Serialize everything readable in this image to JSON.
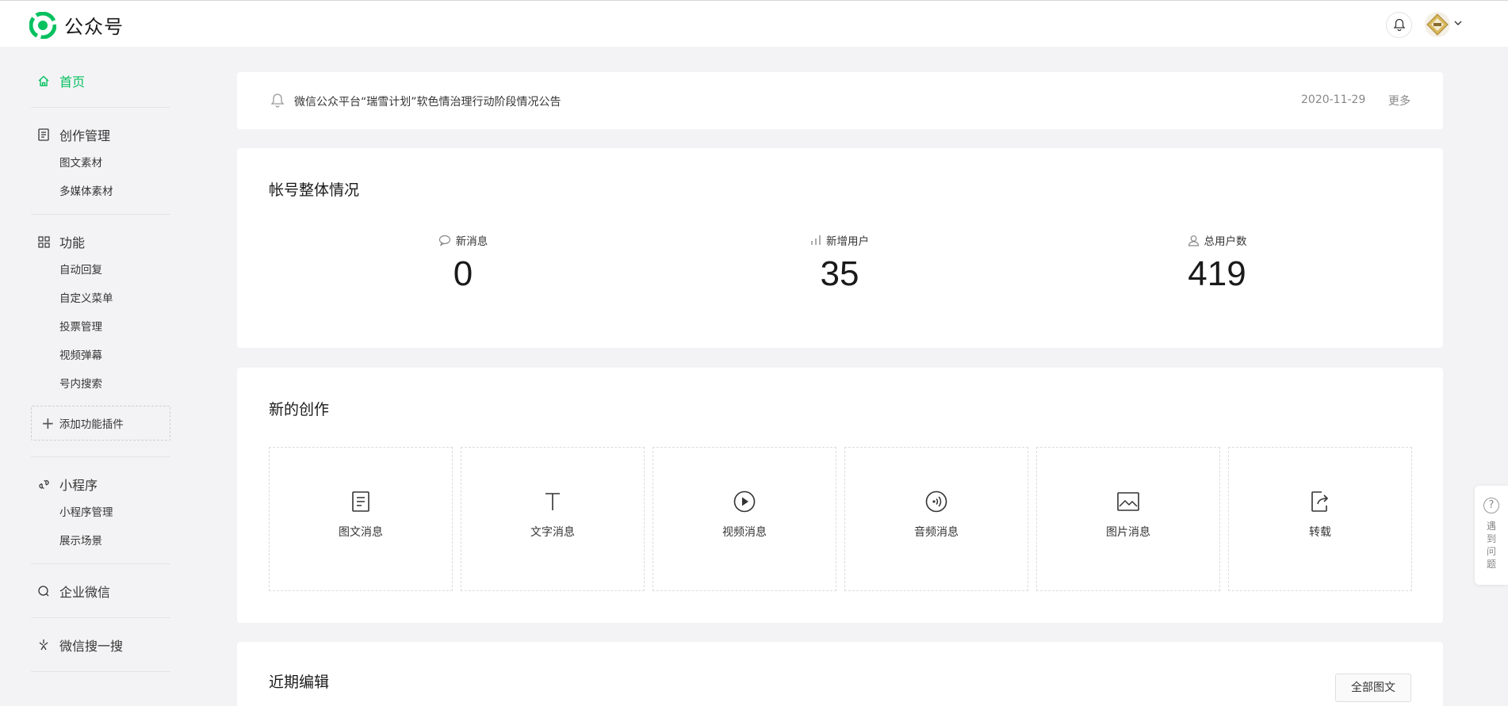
{
  "app": {
    "title": "公众号"
  },
  "header": {
    "bell_icon": "bell-icon",
    "avatar_icon": "avatar-image"
  },
  "sidebar": {
    "home": "首页",
    "creation": {
      "label": "创作管理",
      "items": [
        "图文素材",
        "多媒体素材"
      ]
    },
    "functions": {
      "label": "功能",
      "items": [
        "自动回复",
        "自定义菜单",
        "投票管理",
        "视频弹幕",
        "号内搜索"
      ]
    },
    "add_plugin": "添加功能插件",
    "miniprogram": {
      "label": "小程序",
      "items": [
        "小程序管理",
        "展示场景"
      ]
    },
    "work_wechat": "企业微信",
    "search": "微信搜一搜"
  },
  "notice": {
    "text": "微信公众平台“瑞雪计划”软色情治理行动阶段情况公告",
    "date": "2020-11-29",
    "more": "更多"
  },
  "overview": {
    "title": "帐号整体情况",
    "stats": [
      {
        "label": "新消息",
        "value": "0",
        "icon": "message-icon"
      },
      {
        "label": "新增用户",
        "value": "35",
        "icon": "bar-chart-icon"
      },
      {
        "label": "总用户数",
        "value": "419",
        "icon": "user-icon"
      }
    ]
  },
  "create": {
    "title": "新的创作",
    "tiles": [
      {
        "label": "图文消息",
        "icon": "document-icon"
      },
      {
        "label": "文字消息",
        "icon": "text-icon"
      },
      {
        "label": "视频消息",
        "icon": "play-icon"
      },
      {
        "label": "音频消息",
        "icon": "audio-icon"
      },
      {
        "label": "图片消息",
        "icon": "image-icon"
      },
      {
        "label": "转载",
        "icon": "share-icon"
      }
    ]
  },
  "recent": {
    "title": "近期编辑",
    "all_button": "全部图文"
  },
  "help": {
    "label": "遇到问题",
    "q": "?"
  },
  "colors": {
    "accent": "#07c160",
    "background": "#f3f3f5"
  }
}
